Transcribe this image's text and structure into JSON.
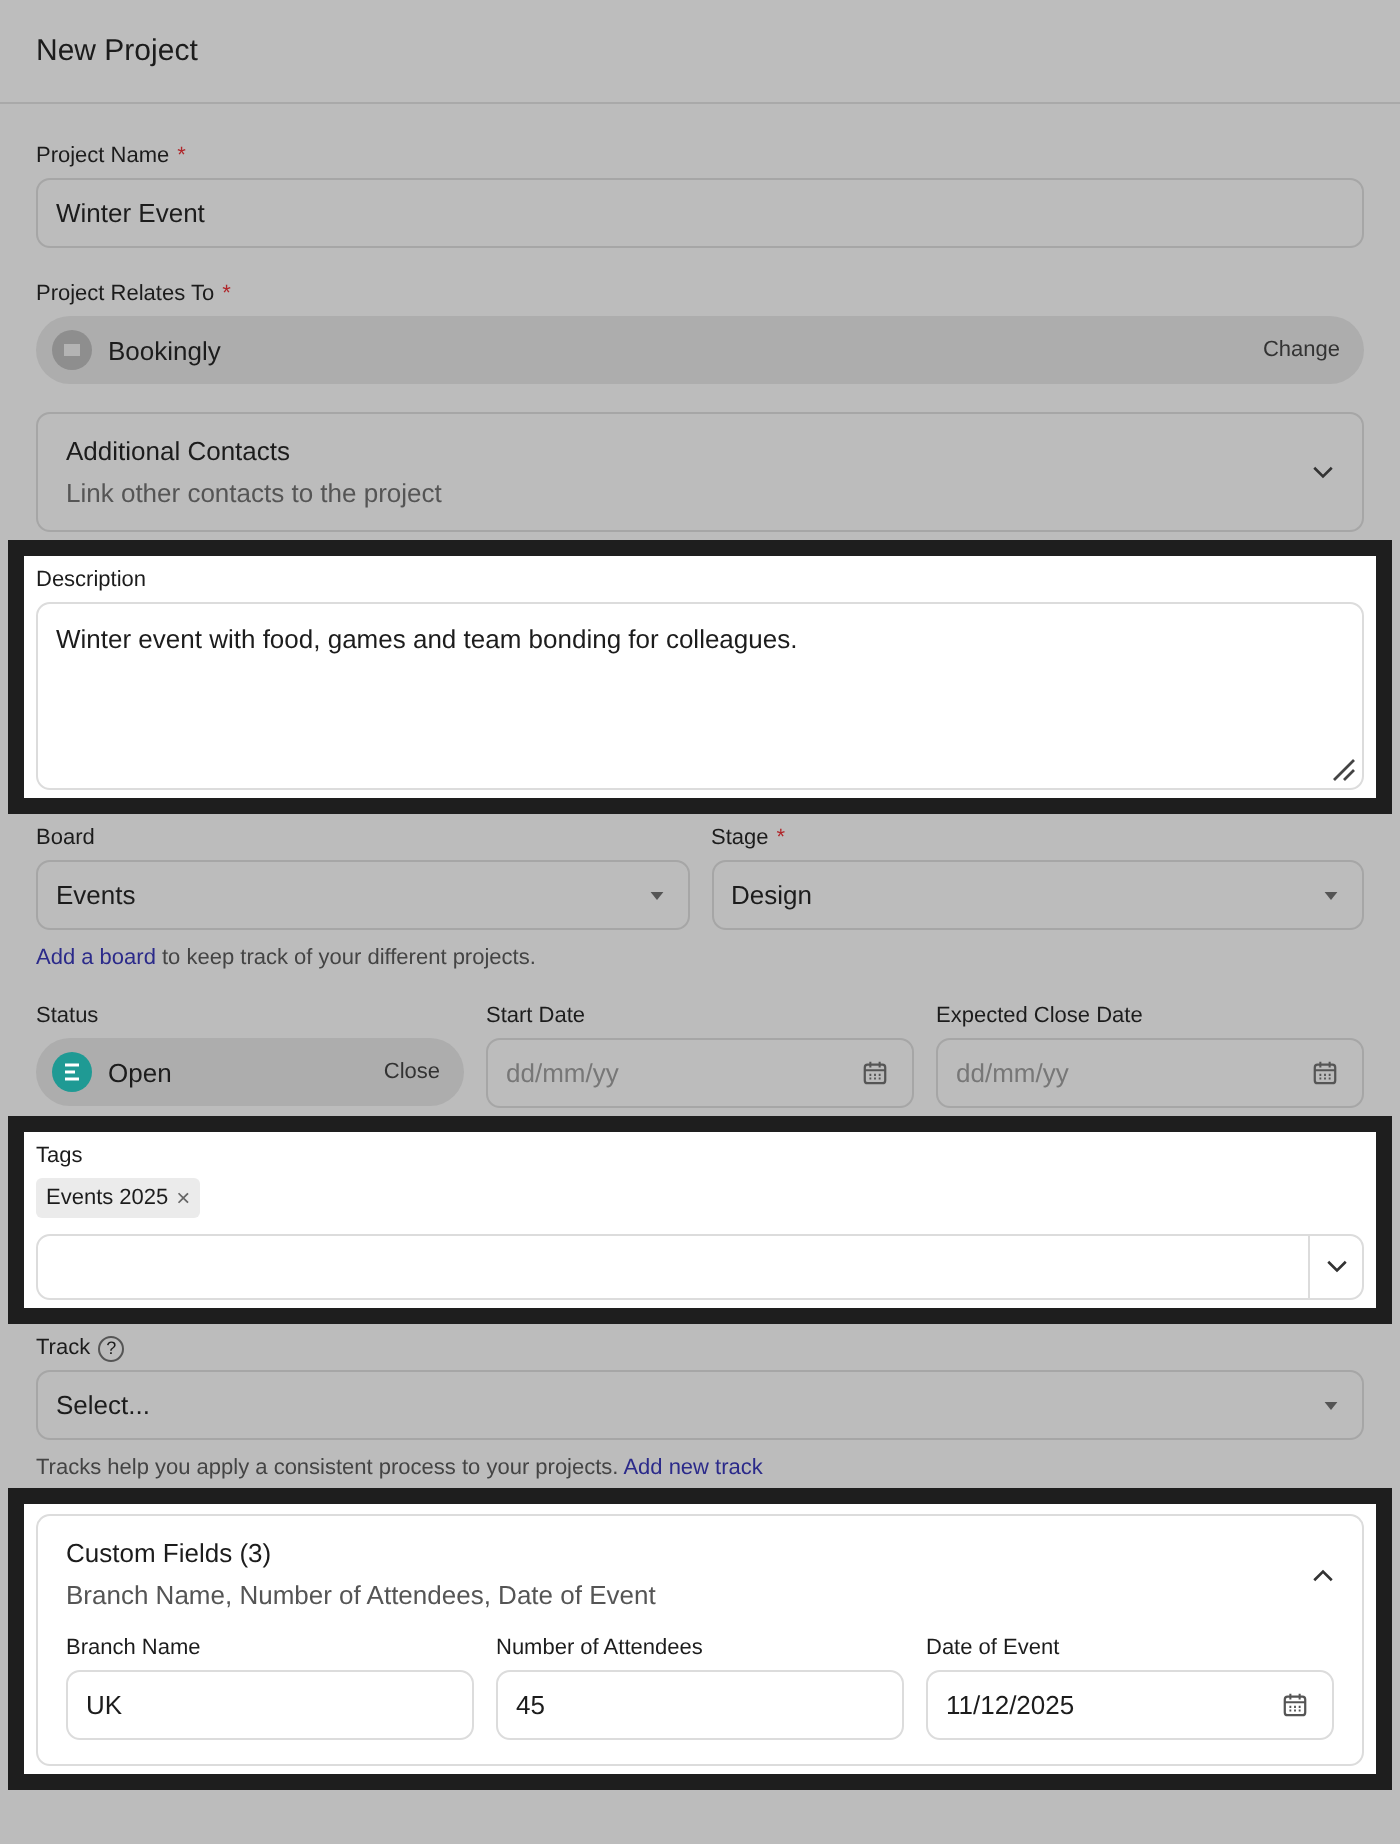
{
  "window": {
    "title": "New Project"
  },
  "project_name": {
    "label": "Project Name",
    "required_mark": "*",
    "value": "Winter Event"
  },
  "relates_to": {
    "label": "Project Relates To",
    "required_mark": "*",
    "value": "Bookingly",
    "action": "Change"
  },
  "additional_contacts": {
    "title": "Additional Contacts",
    "subtitle": "Link other contacts to the project",
    "expanded": false
  },
  "description": {
    "label": "Description",
    "value": "Winter event with food, games and team bonding for colleagues.",
    "highlighted": true
  },
  "board": {
    "label": "Board",
    "value": "Events"
  },
  "stage": {
    "label": "Stage",
    "required_mark": "*",
    "value": "Design"
  },
  "board_help": {
    "link": "Add a board",
    "text": " to keep track of your different projects."
  },
  "status": {
    "label": "Status",
    "value": "Open",
    "action": "Close"
  },
  "start_date": {
    "label": "Start Date",
    "placeholder": "dd/mm/yy"
  },
  "close_date": {
    "label": "Expected Close Date",
    "placeholder": "dd/mm/yy"
  },
  "tags": {
    "label": "Tags",
    "highlighted": true,
    "items": [
      {
        "label": "Events 2025",
        "remove": "×"
      }
    ]
  },
  "track": {
    "label": "Track",
    "help": "?",
    "placeholder": "Select..."
  },
  "track_help": {
    "text": "Tracks help you apply a consistent process to your projects. ",
    "link": "Add new track"
  },
  "custom_fields": {
    "title": "Custom Fields (3)",
    "subtitle": "Branch Name, Number of Attendees, Date of Event",
    "expanded": true,
    "highlighted": true,
    "fields": [
      {
        "kind": "text",
        "label": "Branch Name",
        "value": "UK"
      },
      {
        "kind": "text",
        "label": "Number of Attendees",
        "value": "45"
      },
      {
        "kind": "date",
        "label": "Date of Event",
        "value": "11/12/2025"
      }
    ]
  }
}
